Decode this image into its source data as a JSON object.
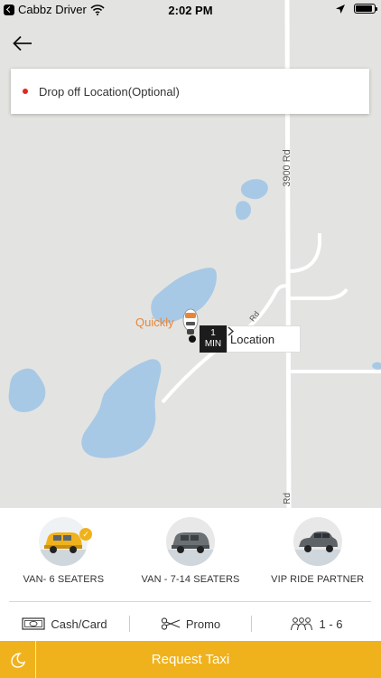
{
  "status_bar": {
    "app_back": "Cabbz Driver",
    "time": "2:02 PM",
    "battery_level": 0.9
  },
  "map": {
    "drop_off_placeholder": "Drop off Location(Optional)",
    "driver_name": "Quickly",
    "eta": {
      "value": "1",
      "unit": "MIN"
    },
    "location_label": "Location",
    "road_labels": [
      "3900 Rd",
      "Rd",
      "Rd"
    ]
  },
  "vehicles": [
    {
      "label": "VAN- 6 SEATERS",
      "icon": "yellow-van-icon",
      "selected": true
    },
    {
      "label": "VAN - 7-14 SEATERS",
      "icon": "grey-van-icon",
      "selected": false
    },
    {
      "label": "VIP RIDE PARTNER",
      "icon": "grey-car-icon",
      "selected": false
    }
  ],
  "options": {
    "payment": "Cash/Card",
    "promo": "Promo",
    "seats": "1 - 6"
  },
  "request_button": "Request Taxi",
  "colors": {
    "accent": "#f0b21c",
    "map_bg": "#e3e4e1",
    "water": "#a8c9e6",
    "road": "#ffffff",
    "drop_dot": "#e2281f",
    "driver_label": "#e6863d"
  }
}
